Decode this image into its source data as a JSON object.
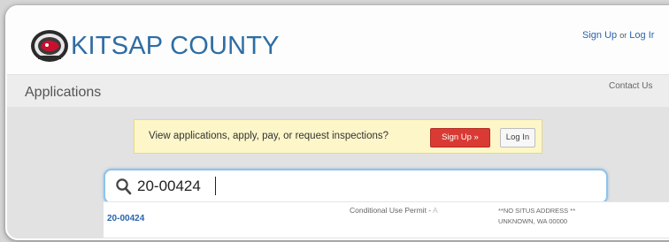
{
  "header": {
    "brand": "KITSAP COUNTY",
    "auth": {
      "signup": "Sign Up",
      "or": "or",
      "login": "Log Ir"
    }
  },
  "titlebar": {
    "title": "Applications",
    "contact": "Contact Us"
  },
  "promo": {
    "text": "View applications, apply, pay, or request inspections?",
    "signup_label": "Sign Up »",
    "login_label": "Log In"
  },
  "search": {
    "value": "20-00424",
    "icon": "search-icon"
  },
  "results": [
    {
      "number": "20-00424",
      "type": "Conditional Use Permit -",
      "type_fade": "A",
      "address_line1": "**NO SITUS ADDRESS **",
      "address_line2": "UNKNOWN, WA 00000"
    }
  ],
  "colors": {
    "brand": "#2e6da4",
    "link": "#2a64ad",
    "signup_button": "#d93b34",
    "promo_bg": "#fdf6c9",
    "search_border": "#8cc3ec"
  }
}
